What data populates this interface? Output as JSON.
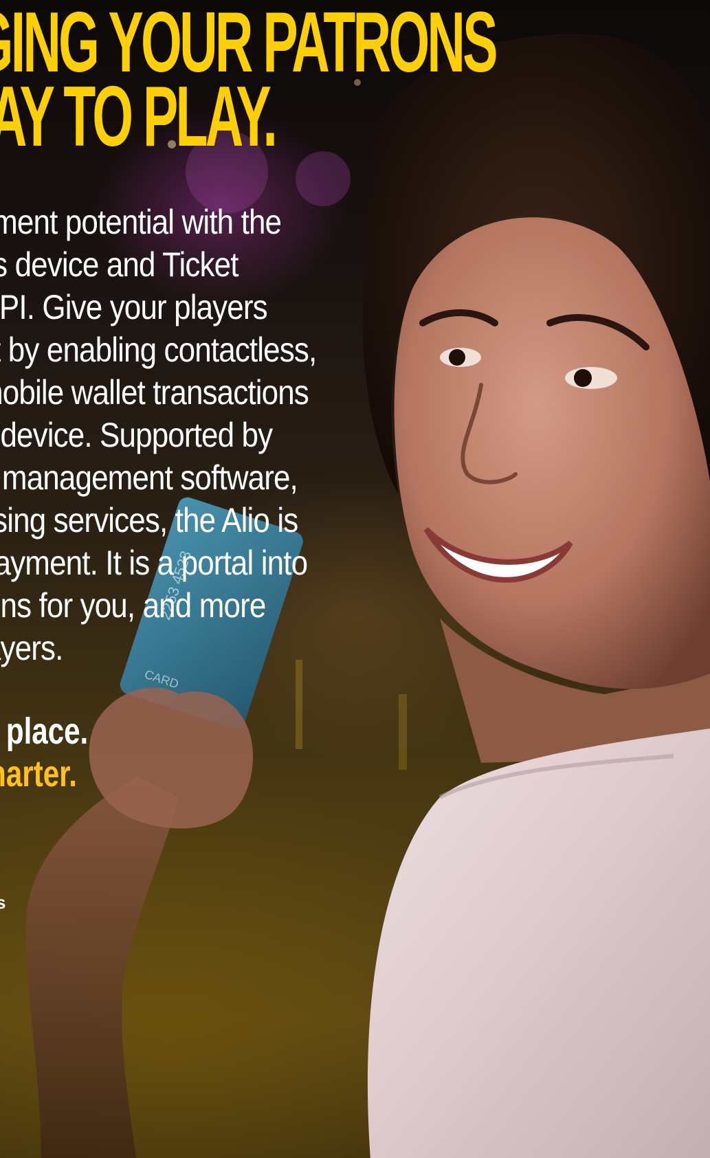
{
  "headline": {
    "line1": "IGING YOUR PATRONS",
    "line2": "VAY TO PLAY."
  },
  "body_lines": [
    "yment potential with the",
    "ss device and Ticket",
    "CPI. Give your players",
    "ct by enabling contactless,",
    "mobile wallet transactions",
    "c device. Supported by",
    "e management software,",
    "ssing services, the Alio is",
    "payment. It is a portal into",
    "ions for you, and more",
    "layers."
  ],
  "tagline": {
    "line1": "he place.",
    "line2": "smarter."
  },
  "small_text": "s",
  "card": {
    "text_1": "2253 4523",
    "text_2": "CARD"
  },
  "colors": {
    "accent_yellow": "#ffd000",
    "accent_gold": "#ffc21a",
    "text": "#ffffff"
  }
}
